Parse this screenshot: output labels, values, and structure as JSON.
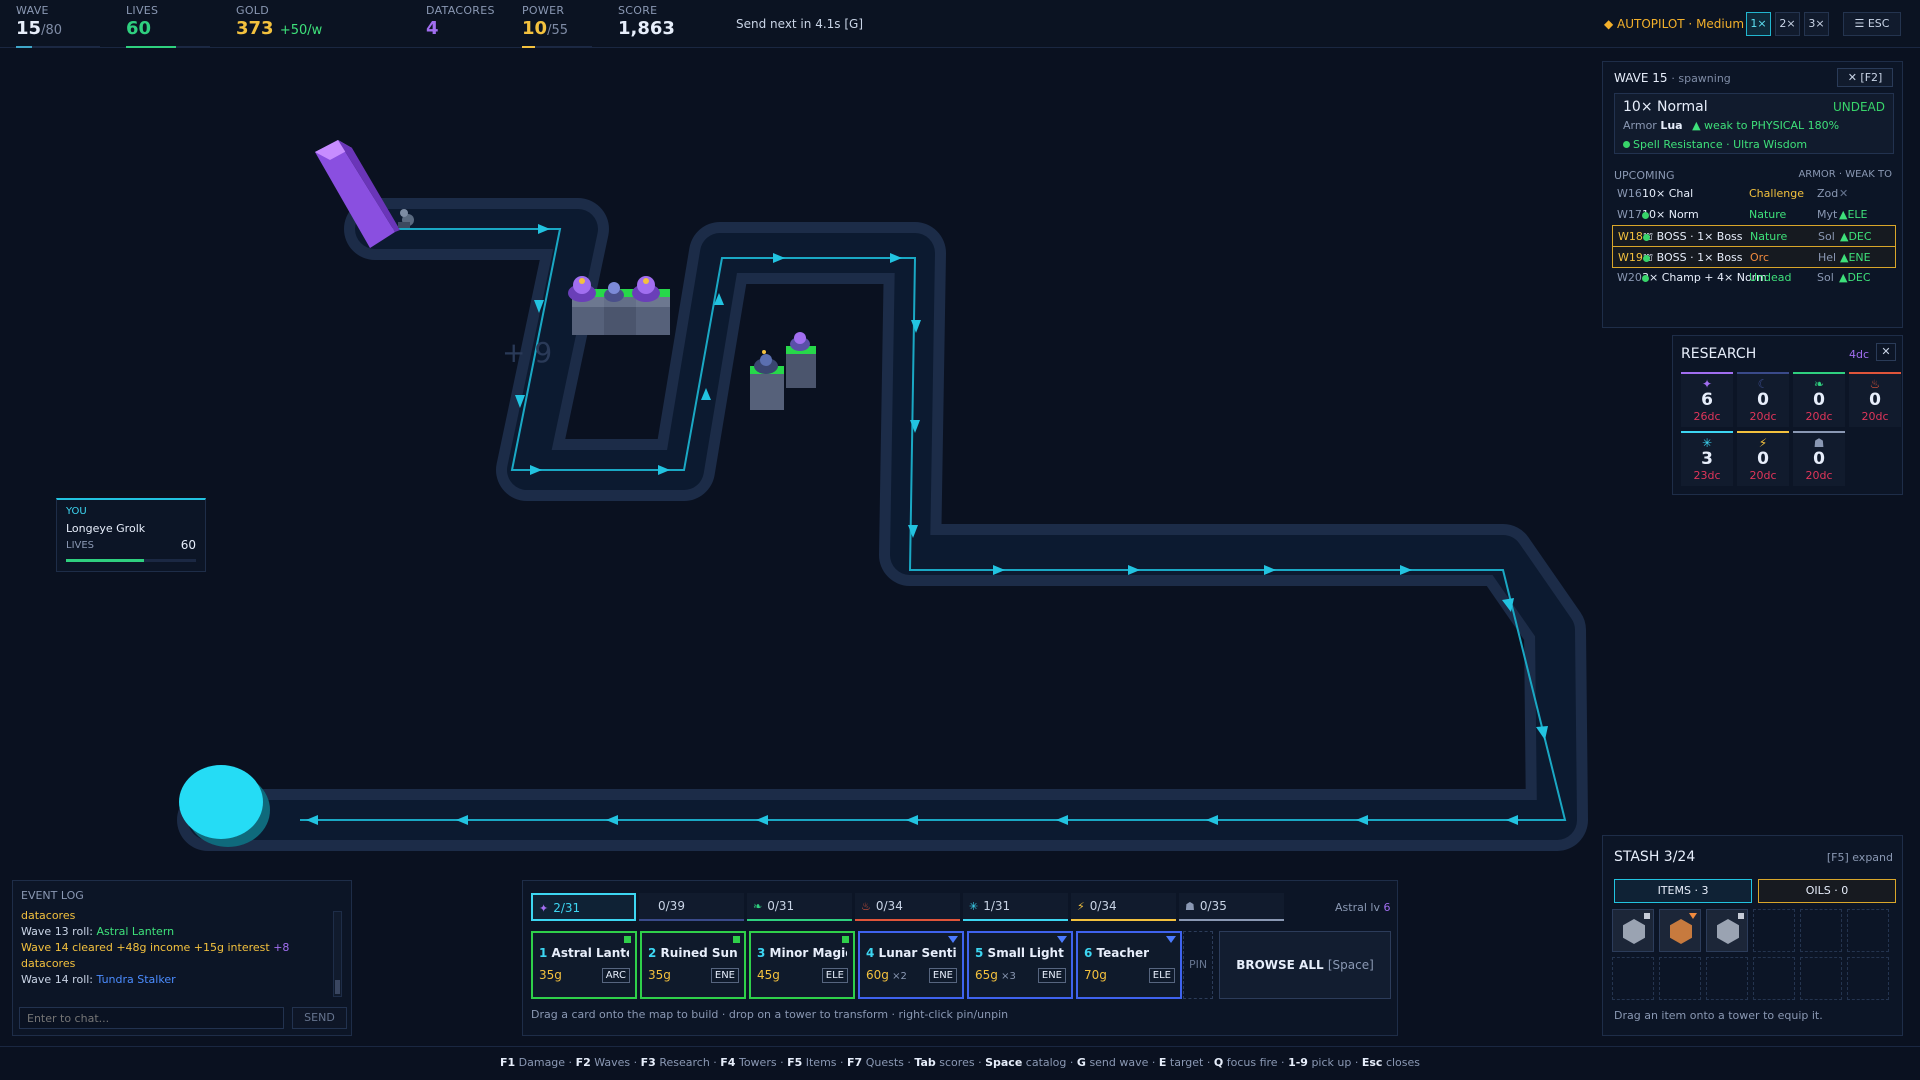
{
  "topbar": {
    "wave": {
      "label": "WAVE",
      "value": "15",
      "total": "/80"
    },
    "lives": {
      "label": "LIVES",
      "value": "60"
    },
    "gold": {
      "label": "GOLD",
      "value": "373",
      "rate": "+50/w"
    },
    "datacores": {
      "label": "DATACORES",
      "value": "4"
    },
    "power": {
      "label": "POWER",
      "value": "10",
      "total": "/55"
    },
    "score": {
      "label": "SCORE",
      "value": "1,863"
    },
    "send_next": "Send next in 4.1s  [G]",
    "autopilot": "◆ AUTOPILOT · Medium",
    "speeds": [
      "1×",
      "2×",
      "3×"
    ],
    "active_speed": "1×",
    "esc_label": "☰ ESC",
    "colors": {
      "wave": "#3fa6c9",
      "lives": "#2fd07f",
      "gold": "#f3c13e",
      "datacores": "#a16ef0",
      "power": "#f3c13e"
    },
    "progress": {
      "wave": 0.1875,
      "lives": 0.6,
      "power": 0.18
    }
  },
  "map": {
    "floating_text": "+ 9"
  },
  "wave_panel": {
    "title": "WAVE 15",
    "state": "· spawning",
    "close": "✕ [F2]",
    "current": {
      "name": "10× Normal",
      "type": "UNDEAD",
      "armor_label": "Armor",
      "armor": "Lua",
      "weakness": "▲ weak to PHYSICAL 180%",
      "traits": "Spell Resistance · Ultra Wisdom"
    },
    "upcoming_label": "UPCOMING",
    "upcoming_cols": "ARMOR · WEAK TO",
    "upcoming": [
      {
        "wave": "W16",
        "name": "10× Chal",
        "class": "Challenge",
        "armor": "Zod",
        "weak": "✕",
        "boss": false,
        "class_color": "#f3c13e",
        "weak_color": "#66748f"
      },
      {
        "wave": "W17",
        "name": "10× Norm",
        "class": "Nature",
        "armor": "Myt",
        "weak": "▲ELE",
        "boss": false,
        "class_color": "#3ee07a",
        "weak_color": "#3ee07a"
      },
      {
        "wave": "W18",
        "name": "⛫ BOSS · 1× Boss",
        "class": "Nature",
        "armor": "Sol",
        "weak": "▲DEC",
        "boss": true,
        "class_color": "#3ee07a",
        "weak_color": "#3ee07a"
      },
      {
        "wave": "W19",
        "name": "⛫ BOSS · 1× Boss",
        "class": "Orc",
        "armor": "Hel",
        "weak": "▲ENE",
        "boss": true,
        "class_color": "#f08a3e",
        "weak_color": "#3ee07a"
      },
      {
        "wave": "W20",
        "name": "3× Champ + 4× Norm",
        "class": "Undead",
        "armor": "Sol",
        "weak": "▲DEC",
        "boss": false,
        "class_color": "#3ee07a",
        "weak_color": "#3ee07a"
      }
    ]
  },
  "research": {
    "title": "RESEARCH",
    "datacores": "4dc",
    "close": "✕",
    "items": [
      {
        "icon": "✦",
        "icon_name": "astral-icon",
        "level": "6",
        "cost": "26dc",
        "color": "#a16ef0"
      },
      {
        "icon": "☾",
        "icon_name": "moon-icon",
        "level": "0",
        "cost": "20dc",
        "color": "#3a4a8a"
      },
      {
        "icon": "❧",
        "icon_name": "leaf-icon",
        "level": "0",
        "cost": "20dc",
        "color": "#2fd07f"
      },
      {
        "icon": "♨",
        "icon_name": "fire-icon",
        "level": "0",
        "cost": "20dc",
        "color": "#e0553a"
      },
      {
        "icon": "✳",
        "icon_name": "frost-icon",
        "level": "3",
        "cost": "23dc",
        "color": "#3dd6f2"
      },
      {
        "icon": "⚡",
        "icon_name": "lightning-icon",
        "level": "0",
        "cost": "20dc",
        "color": "#f3c13e"
      },
      {
        "icon": "☗",
        "icon_name": "anvil-icon",
        "level": "0",
        "cost": "20dc",
        "color": "#8a98b3"
      }
    ]
  },
  "player": {
    "you": "YOU",
    "name": "Longeye Grolk",
    "lives_label": "LIVES",
    "lives": "60",
    "lives_fraction": 0.6
  },
  "event_log": {
    "title": "EVENT LOG",
    "lines": [
      {
        "text": "datacores",
        "cls": "hl"
      },
      {
        "parts": [
          {
            "t": "Wave 13 roll: ",
            "c": ""
          },
          {
            "t": "Astral Lantern",
            "c": "grn"
          }
        ]
      },
      {
        "parts": [
          {
            "t": "Wave 14 cleared  +48g income  +15g interest  ",
            "c": "hl"
          },
          {
            "t": "+8",
            "c": "pur"
          }
        ]
      },
      {
        "text": "datacores",
        "cls": "hl"
      },
      {
        "parts": [
          {
            "t": "Wave 14 roll: ",
            "c": ""
          },
          {
            "t": "Tundra Stalker",
            "c": "blu"
          }
        ]
      }
    ],
    "chat_placeholder": "Enter to chat...",
    "send": "SEND"
  },
  "build": {
    "tabs": [
      {
        "icon": "✦",
        "icon_name": "astral-icon",
        "label": "2/31",
        "color": "#a16ef0",
        "active": true
      },
      {
        "icon": "",
        "icon_name": "",
        "label": "0/39",
        "color": "#3a4a8a",
        "active": false
      },
      {
        "icon": "❧",
        "icon_name": "leaf-icon",
        "label": "0/31",
        "color": "#2fd07f",
        "active": false
      },
      {
        "icon": "♨",
        "icon_name": "fire-icon",
        "label": "0/34",
        "color": "#e0553a",
        "active": false
      },
      {
        "icon": "✳",
        "icon_name": "frost-icon",
        "label": "1/31",
        "color": "#3dd6f2",
        "active": false
      },
      {
        "icon": "⚡",
        "icon_name": "lightning-icon",
        "label": "0/34",
        "color": "#f3c13e",
        "active": false
      },
      {
        "icon": "☗",
        "icon_name": "anvil-icon",
        "label": "0/35",
        "color": "#8a98b3",
        "active": false
      }
    ],
    "astral_label": "Astral lv ",
    "astral_level": "6",
    "cards": [
      {
        "key": "1",
        "name": "Astral Lantern",
        "price": "35g",
        "mult": "",
        "type": "ARC",
        "rarity": "green"
      },
      {
        "key": "2",
        "name": "Ruined Sun",
        "price": "35g",
        "mult": "",
        "type": "ENE",
        "rarity": "green"
      },
      {
        "key": "3",
        "name": "Minor Magic",
        "price": "45g",
        "mult": "",
        "type": "ELE",
        "rarity": "green"
      },
      {
        "key": "4",
        "name": "Lunar Sentinel",
        "price": "60g",
        "mult": " ×2",
        "type": "ENE",
        "rarity": "blue"
      },
      {
        "key": "5",
        "name": "Small Light",
        "price": "65g",
        "mult": " ×3",
        "type": "ENE",
        "rarity": "blue"
      },
      {
        "key": "6",
        "name": "Teacher",
        "price": "70g",
        "mult": "",
        "type": "ELE",
        "rarity": "blue"
      }
    ],
    "pin": "PIN",
    "browse": "BROWSE ALL",
    "browse_key": "[Space]",
    "hint": "Drag a card onto the map to build · drop on a tower to transform · right-click pin/unpin"
  },
  "stash": {
    "title": "STASH 3/24",
    "expand": "[F5] expand",
    "items_tab": "ITEMS · 3",
    "oils_tab": "OILS · 0",
    "slots": [
      {
        "filled": true,
        "color": "grey"
      },
      {
        "filled": true,
        "color": "orange"
      },
      {
        "filled": true,
        "color": "grey"
      },
      {
        "filled": false
      },
      {
        "filled": false
      },
      {
        "filled": false
      },
      {
        "filled": false
      },
      {
        "filled": false
      },
      {
        "filled": false
      },
      {
        "filled": false
      },
      {
        "filled": false
      },
      {
        "filled": false
      }
    ],
    "hint": "Drag an item onto a tower to equip it."
  },
  "hotkeys": [
    {
      "k": "F1",
      "t": "Damage"
    },
    {
      "k": "F2",
      "t": "Waves"
    },
    {
      "k": "F3",
      "t": "Research"
    },
    {
      "k": "F4",
      "t": "Towers"
    },
    {
      "k": "F5",
      "t": "Items"
    },
    {
      "k": "F7",
      "t": "Quests"
    },
    {
      "k": "Tab",
      "t": "scores"
    },
    {
      "k": "Space",
      "t": "catalog"
    },
    {
      "k": "G",
      "t": "send wave"
    },
    {
      "k": "E",
      "t": "target"
    },
    {
      "k": "Q",
      "t": "focus fire"
    },
    {
      "k": "1-9",
      "t": "pick up"
    },
    {
      "k": "Esc",
      "t": "closes"
    }
  ]
}
